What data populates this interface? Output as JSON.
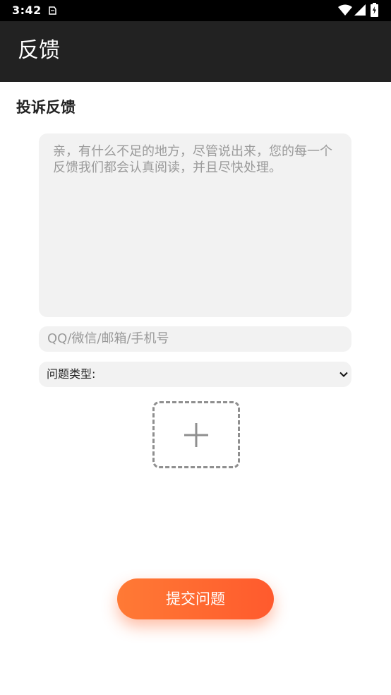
{
  "status_bar": {
    "time": "3:42",
    "icons": [
      "notification-icon",
      "wifi-icon",
      "signal-icon",
      "battery-icon"
    ]
  },
  "app_bar": {
    "title": "反馈"
  },
  "form": {
    "section_title": "投诉反馈",
    "feedback_placeholder": "亲，有什么不足的地方，尽管说出来，您的每一个反馈我们都会认真阅读，并且尽快处理。",
    "contact_placeholder": "QQ/微信/邮箱/手机号",
    "type_select_label": "问题类型:",
    "upload_icon": "plus-icon",
    "submit_label": "提交问题"
  },
  "colors": {
    "app_bar": "#222222",
    "input_bg": "#f2f2f2",
    "submit_start": "#ff7a35",
    "submit_end": "#ff5a2d"
  }
}
